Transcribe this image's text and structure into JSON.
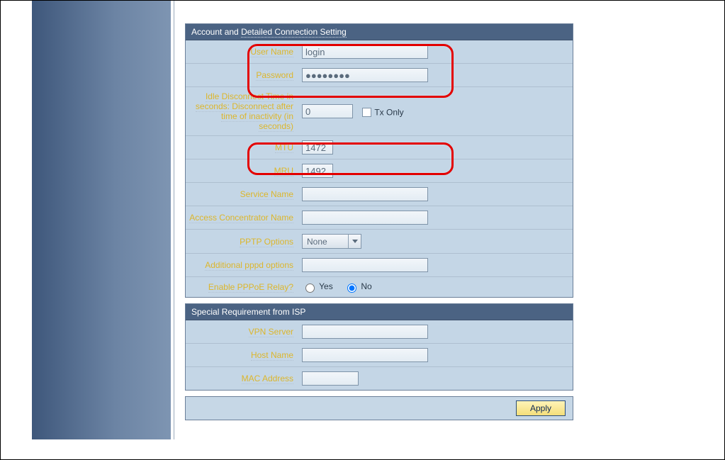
{
  "section1": {
    "title_plain": "Account and ",
    "title_dotted": "Detailed Connection Setting",
    "labels": {
      "user_name": "User Name",
      "password": "Password",
      "idle_line1": "Idle Disconnect Time in",
      "idle_line2": "seconds: Disconnect after",
      "idle_line3": "time of inactivity (in",
      "idle_line4": "seconds)",
      "tx_only": "Tx Only",
      "mtu": "MTU",
      "mru": "MRU",
      "service_name": "Service Name",
      "access_concentrator": "Access Concentrator Name",
      "pptp_options": "PPTP Options",
      "additional_pppd": "Additional pppd options",
      "enable_pppoe_relay": "Enable PPPoE Relay?"
    },
    "values": {
      "user_name": "login",
      "password": "●●●●●●●●",
      "idle": "0",
      "tx_only_checked": false,
      "mtu": "1472",
      "mru": "1492",
      "service_name": "",
      "access_concentrator": "",
      "pptp_option": "None",
      "additional_pppd": ""
    },
    "radio": {
      "yes": "Yes",
      "no": "No",
      "selected": "no"
    }
  },
  "section2": {
    "title": "Special Requirement from ISP",
    "labels": {
      "vpn_server": "VPN Server",
      "host_name": "Host Name",
      "mac_address": "MAC Address"
    },
    "values": {
      "vpn_server": "",
      "host_name": "",
      "mac_address": ""
    }
  },
  "apply": {
    "label": "Apply"
  }
}
